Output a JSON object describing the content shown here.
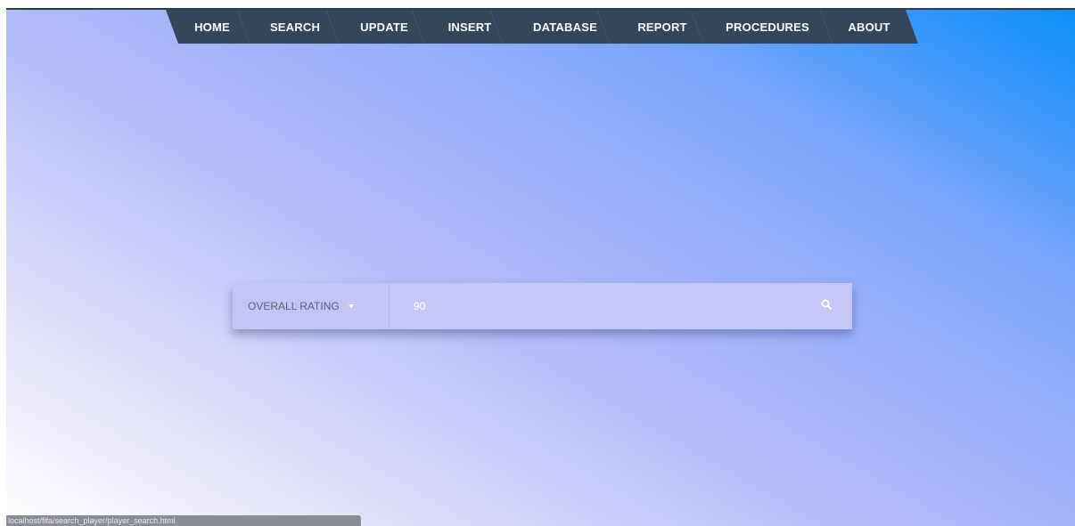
{
  "nav": {
    "items": [
      {
        "label": "HOME"
      },
      {
        "label": "SEARCH"
      },
      {
        "label": "UPDATE"
      },
      {
        "label": "INSERT"
      },
      {
        "label": "DATABASE"
      },
      {
        "label": "REPORT"
      },
      {
        "label": "PROCEDURES"
      },
      {
        "label": "ABOUT"
      }
    ]
  },
  "search": {
    "filter_selected": "OVERALL RATING",
    "query_value": "90",
    "search_icon": "search-icon"
  },
  "status_bar": {
    "url": "localhost/fifa/search_player/player_search.html"
  },
  "colors": {
    "nav_background": "#34475a",
    "nav_text": "#ffffff",
    "gradient_start": "#ffffff",
    "gradient_end": "#0a90f7"
  }
}
